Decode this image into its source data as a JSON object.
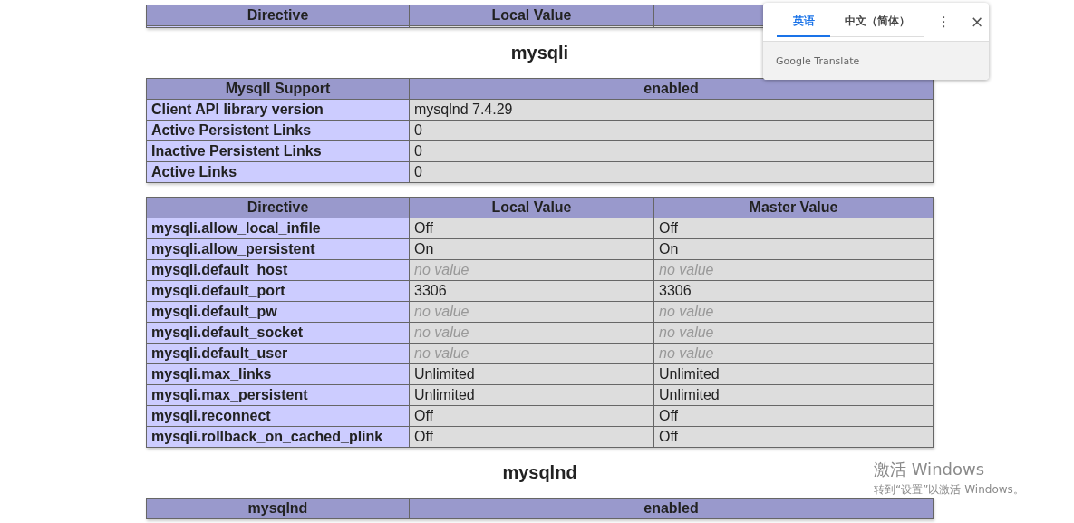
{
  "top_table": {
    "columns": [
      "Directive",
      "Local Value"
    ]
  },
  "sections": [
    {
      "title": "mysqli",
      "tables": [
        {
          "columns": [
            "MysqlI Support",
            "enabled"
          ],
          "rows": [
            {
              "label": "Client API library version",
              "values": [
                {
                  "text": "mysqlnd 7.4.29",
                  "kind": "value"
                }
              ]
            },
            {
              "label": "Active Persistent Links",
              "values": [
                {
                  "text": "0",
                  "kind": "value"
                }
              ]
            },
            {
              "label": "Inactive Persistent Links",
              "values": [
                {
                  "text": "0",
                  "kind": "value"
                }
              ]
            },
            {
              "label": "Active Links",
              "values": [
                {
                  "text": "0",
                  "kind": "value"
                }
              ]
            }
          ]
        },
        {
          "columns": [
            "Directive",
            "Local Value",
            "Master Value"
          ],
          "rows": [
            {
              "label": "mysqli.allow_local_infile",
              "values": [
                {
                  "text": "Off",
                  "kind": "value"
                },
                {
                  "text": "Off",
                  "kind": "value"
                }
              ]
            },
            {
              "label": "mysqli.allow_persistent",
              "values": [
                {
                  "text": "On",
                  "kind": "value"
                },
                {
                  "text": "On",
                  "kind": "value"
                }
              ]
            },
            {
              "label": "mysqli.default_host",
              "values": [
                {
                  "text": "no value",
                  "kind": "no_value"
                },
                {
                  "text": "no value",
                  "kind": "no_value"
                }
              ]
            },
            {
              "label": "mysqli.default_port",
              "values": [
                {
                  "text": "3306",
                  "kind": "value"
                },
                {
                  "text": "3306",
                  "kind": "value"
                }
              ]
            },
            {
              "label": "mysqli.default_pw",
              "values": [
                {
                  "text": "no value",
                  "kind": "no_value"
                },
                {
                  "text": "no value",
                  "kind": "no_value"
                }
              ]
            },
            {
              "label": "mysqli.default_socket",
              "values": [
                {
                  "text": "no value",
                  "kind": "no_value"
                },
                {
                  "text": "no value",
                  "kind": "no_value"
                }
              ]
            },
            {
              "label": "mysqli.default_user",
              "values": [
                {
                  "text": "no value",
                  "kind": "no_value"
                },
                {
                  "text": "no value",
                  "kind": "no_value"
                }
              ]
            },
            {
              "label": "mysqli.max_links",
              "values": [
                {
                  "text": "Unlimited",
                  "kind": "value"
                },
                {
                  "text": "Unlimited",
                  "kind": "value"
                }
              ]
            },
            {
              "label": "mysqli.max_persistent",
              "values": [
                {
                  "text": "Unlimited",
                  "kind": "value"
                },
                {
                  "text": "Unlimited",
                  "kind": "value"
                }
              ]
            },
            {
              "label": "mysqli.reconnect",
              "values": [
                {
                  "text": "Off",
                  "kind": "value"
                },
                {
                  "text": "Off",
                  "kind": "value"
                }
              ]
            },
            {
              "label": "mysqli.rollback_on_cached_plink",
              "values": [
                {
                  "text": "Off",
                  "kind": "value"
                },
                {
                  "text": "Off",
                  "kind": "value"
                }
              ]
            }
          ]
        }
      ]
    },
    {
      "title": "mysqlnd",
      "tables": [
        {
          "columns": [
            "mysqlnd",
            "enabled"
          ]
        }
      ]
    }
  ],
  "translate_popup": {
    "tabs": [
      {
        "label": "英语",
        "selected": true
      },
      {
        "label": "中文（简体）",
        "selected": false
      }
    ],
    "more": "⋮",
    "close": "×",
    "footer": "Google Translate"
  },
  "activation_notice": {
    "title": "激活 Windows",
    "text": "转到“设置”以激活 Windows。"
  }
}
